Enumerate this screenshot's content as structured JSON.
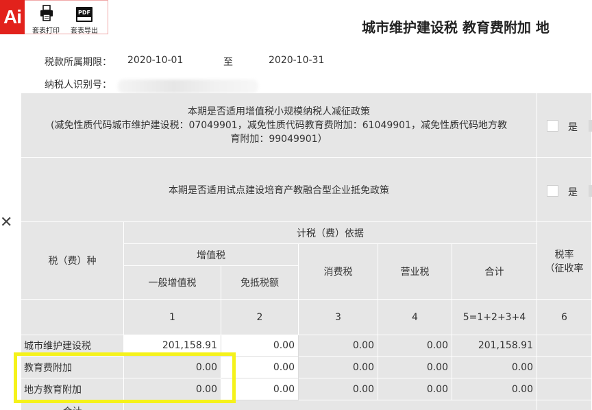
{
  "logo": {
    "text": "Ai"
  },
  "toolbar": {
    "print_label": "套表打印",
    "export_label": "套表导出",
    "export_icon_text": "PDF"
  },
  "header": {
    "title": "城市维护建设税 教育费附加 地"
  },
  "period": {
    "label": "税款所属期限：",
    "start": "2020-10-01",
    "to": "至",
    "end": "2020-10-31"
  },
  "taxpayer": {
    "label": "纳税人识别号：",
    "value": ""
  },
  "policy1": {
    "line1": "本期是否适用增值税小规模纳税人减征政策",
    "line2": "(减免性质代码城市维护建设税：07049901，减免性质代码教育费附加：61049901，减免性质代码地方教",
    "line3": "育附加：99049901）",
    "yes_label": "是"
  },
  "policy2": {
    "text": "本期是否适用试点建设培育产教融合型企业抵免政策",
    "yes_label": "是"
  },
  "table": {
    "col_tax_type": "税（费）种",
    "basis_header": "计税（费）依据",
    "vat_header": "增值税",
    "general_vat": "一般增值税",
    "exempt_amount": "免抵税额",
    "consumption_tax": "消费税",
    "business_tax": "营业税",
    "total": "合计",
    "rate_line1": "税率",
    "rate_line2": "（征收率",
    "col_nums": [
      "1",
      "2",
      "3",
      "4",
      "5=1+2+3+4",
      "6"
    ],
    "rows": [
      {
        "name": "城市维护建设税",
        "c1": "201,158.91",
        "c2": "0.00",
        "c3": "0.00",
        "c4": "0.00",
        "c5": "201,158.91"
      },
      {
        "name": "教育费附加",
        "c1": "0.00",
        "c2": "0.00",
        "c3": "0.00",
        "c4": "0.00",
        "c5": "0.00"
      },
      {
        "name": "地方教育附加",
        "c1": "0.00",
        "c2": "0.00",
        "c3": "0.00",
        "c4": "0.00",
        "c5": "0.00"
      }
    ],
    "partial_row": "合计"
  },
  "colors": {
    "brand_red": "#e2221c",
    "header_gray": "#e6e6e6",
    "highlight_yellow": "#f5f21a"
  },
  "icons": [
    "printer-icon",
    "pdf-icon",
    "close-icon"
  ]
}
